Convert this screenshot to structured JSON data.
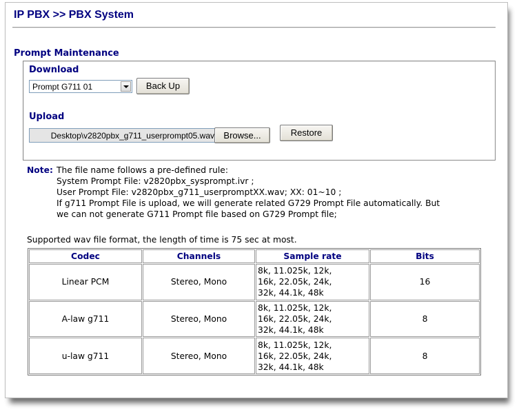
{
  "header": {
    "title": "IP PBX >> PBX System"
  },
  "section": {
    "title": "Prompt Maintenance"
  },
  "download": {
    "label": "Download",
    "selected": "Prompt G711 01",
    "backup_button": "Back Up"
  },
  "upload": {
    "label": "Upload",
    "file_value": "Desktop\\v2820pbx_g711_userprompt05.wav",
    "browse_button": "Browse...",
    "restore_button": "Restore"
  },
  "note": {
    "label": "Note:",
    "lines": [
      "The file name follows a pre-defined rule:",
      "System Prompt File: v2820pbx_sysprompt.ivr ;",
      "User Prompt File: v2820pbx_g711_userpromptXX.wav; XX: 01~10 ;",
      "If g711 Prompt File is upload, we will generate related G729 Prompt File automatically. But",
      "we can not generate G711 Prompt file based on G729 Prompt file;"
    ]
  },
  "support_text": "Supported wav file format, the length of time is 75 sec at most.",
  "table": {
    "headers": [
      "Codec",
      "Channels",
      "Sample rate",
      "Bits"
    ],
    "rows": [
      {
        "codec": "Linear PCM",
        "channels": "Stereo, Mono",
        "rates": [
          "8k, 11.025k, 12k,",
          "16k, 22.05k, 24k,",
          "32k, 44.1k, 48k"
        ],
        "bits": "16"
      },
      {
        "codec": "A-law g711",
        "channels": "Stereo, Mono",
        "rates": [
          "8k, 11.025k, 12k,",
          "16k, 22.05k, 24k,",
          "32k, 44.1k, 48k"
        ],
        "bits": "8"
      },
      {
        "codec": "u-law g711",
        "channels": "Stereo, Mono",
        "rates": [
          "8k, 11.025k, 12k,",
          "16k, 22.05k, 24k,",
          "32k, 44.1k, 48k"
        ],
        "bits": "8"
      }
    ]
  },
  "colors": {
    "heading": "#000080",
    "border": "#8a8a8a"
  },
  "icons": {
    "select_arrow": "chevron-down-icon"
  }
}
